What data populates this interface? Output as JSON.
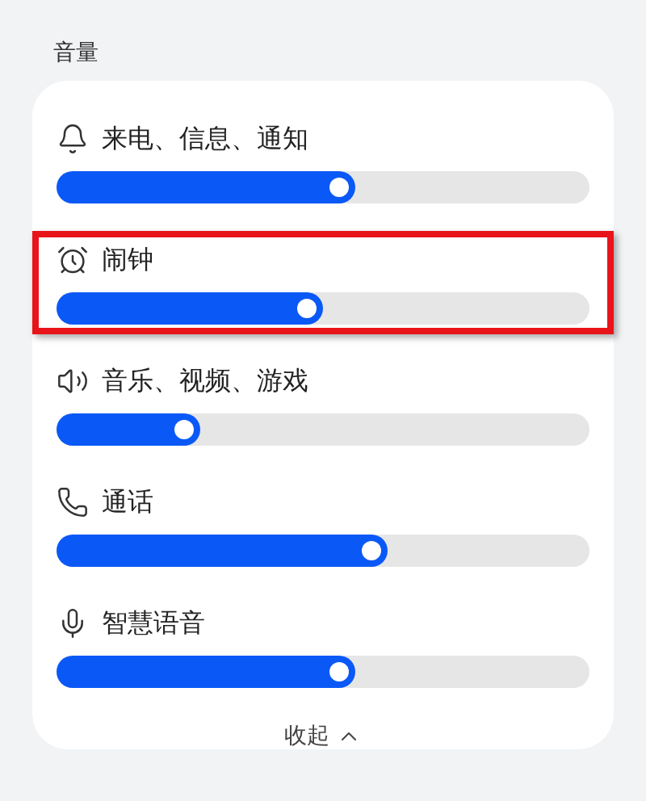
{
  "section_title": "音量",
  "channels": [
    {
      "name": "来电、信息、通知",
      "level": 0.56,
      "highlighted": false
    },
    {
      "name": "闹钟",
      "level": 0.5,
      "highlighted": true
    },
    {
      "name": "音乐、视频、游戏",
      "level": 0.27,
      "highlighted": false
    },
    {
      "name": "通话",
      "level": 0.62,
      "highlighted": false
    },
    {
      "name": "智慧语音",
      "level": 0.56,
      "highlighted": false
    }
  ],
  "collapse_button": {
    "label": "收起"
  }
}
